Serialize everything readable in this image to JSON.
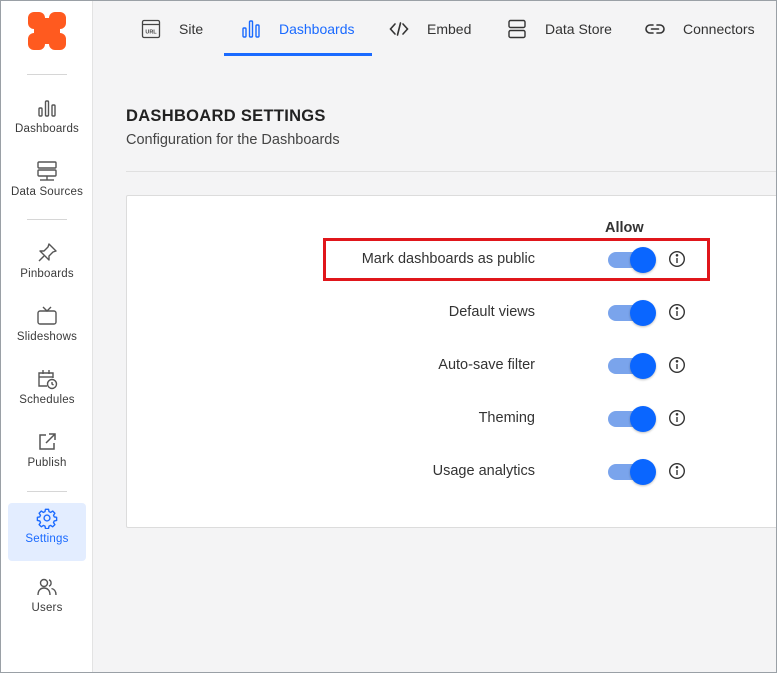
{
  "colors": {
    "accent": "#1a6aff",
    "toggle_thumb": "#0a66ff",
    "toggle_track": "#7aa4ec",
    "logo": "#ff5a1f",
    "highlight": "#e0161b",
    "active_bg": "#e3edff"
  },
  "sidebar": {
    "logo_icon": "brand-logo",
    "items": [
      {
        "label": "Dashboards",
        "icon": "bar-chart-icon",
        "active": false
      },
      {
        "label": "Data Sources",
        "icon": "server-icon",
        "active": false
      },
      {
        "label": "Pinboards",
        "icon": "pin-icon",
        "active": false
      },
      {
        "label": "Slideshows",
        "icon": "tv-icon",
        "active": false
      },
      {
        "label": "Schedules",
        "icon": "calendar-clock-icon",
        "active": false
      },
      {
        "label": "Publish",
        "icon": "share-icon",
        "active": false
      },
      {
        "label": "Settings",
        "icon": "gear-icon",
        "active": true
      },
      {
        "label": "Users",
        "icon": "users-icon",
        "active": false
      }
    ]
  },
  "tabs": [
    {
      "label": "Site",
      "icon": "url-icon",
      "active": false
    },
    {
      "label": "Dashboards",
      "icon": "bar-chart-icon",
      "active": true
    },
    {
      "label": "Embed",
      "icon": "code-icon",
      "active": false
    },
    {
      "label": "Data Store",
      "icon": "database-icon",
      "active": false
    },
    {
      "label": "Connectors",
      "icon": "link-icon",
      "active": false
    }
  ],
  "page": {
    "title": "DASHBOARD SETTINGS",
    "subtitle": "Configuration for the Dashboards"
  },
  "settings": {
    "column_header": "Allow",
    "rows": [
      {
        "label": "Mark dashboards as public",
        "enabled": true,
        "highlighted": true
      },
      {
        "label": "Default views",
        "enabled": true,
        "highlighted": false
      },
      {
        "label": "Auto-save filter",
        "enabled": true,
        "highlighted": false
      },
      {
        "label": "Theming",
        "enabled": true,
        "highlighted": false
      },
      {
        "label": "Usage analytics",
        "enabled": true,
        "highlighted": false
      }
    ]
  }
}
